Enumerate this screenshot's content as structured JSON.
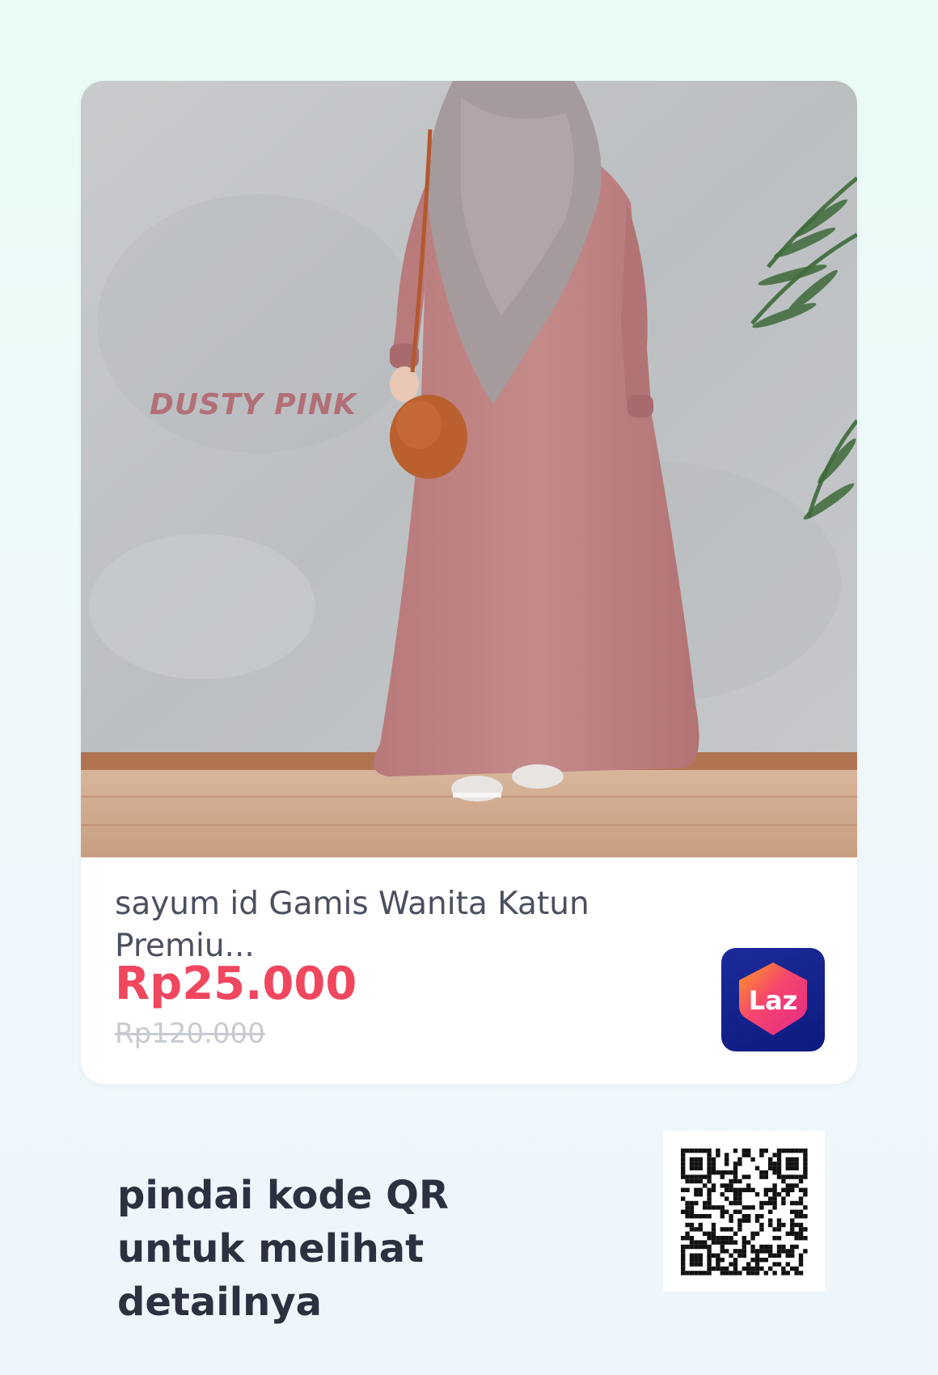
{
  "product": {
    "image_label": "DUSTY PINK",
    "title": "sayum id Gamis Wanita Katun Premiu...",
    "price": "Rp25.000",
    "original_price": "Rp120.000"
  },
  "store": {
    "logo_text": "Laz",
    "icon": "lazada-heart-icon"
  },
  "qr_section": {
    "text": "pindai kode QR untuk melihat detailnya"
  },
  "colors": {
    "price": "#f0465e",
    "old_price": "#c7cbd1",
    "title": "#4b5060",
    "scan_text": "#2c3140",
    "logo_bg": "#0d1a7e"
  }
}
